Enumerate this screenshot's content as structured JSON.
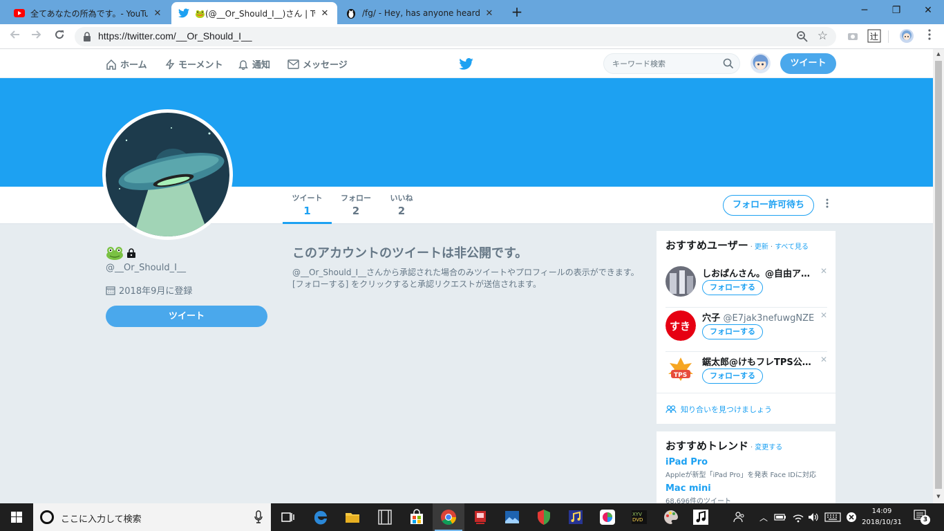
{
  "browser": {
    "tabs": [
      {
        "title": "全てあなたの所為です。- YouTube"
      },
      {
        "title": "🐸(@__Or_Should_I__)さん | Twitter"
      },
      {
        "title": "/fg/ - Hey, has anyone heard abo"
      }
    ],
    "url": "https://twitter.com/__Or_Should_I__"
  },
  "header": {
    "nav": [
      {
        "label": "ホーム"
      },
      {
        "label": "モーメント"
      },
      {
        "label": "通知"
      },
      {
        "label": "メッセージ"
      }
    ],
    "search_placeholder": "キーワード検索",
    "tweet_button": "ツイート"
  },
  "profile": {
    "stats": [
      {
        "label": "ツイート",
        "value": "1"
      },
      {
        "label": "フォロー",
        "value": "2"
      },
      {
        "label": "いいね",
        "value": "2"
      }
    ],
    "follow_button": "フォロー許可待ち",
    "handle": "@__Or_Should_I__",
    "joined": "2018年9月に登録",
    "tweet_button": "ツイート"
  },
  "protected": {
    "title": "このアカウントのツイートは非公開です。",
    "body": "@__Or_Should_I__さんから承認された場合のみツイートやプロフィールの表示ができます。[フォローする] をクリックすると承認リクエストが送信されます。"
  },
  "who_to_follow": {
    "title": "おすすめユーザー",
    "refresh": "更新",
    "view_all": "すべて見る",
    "users": [
      {
        "name": "しおぱんさん。@自由ア…",
        "screen_name": "",
        "follow": "フォローする"
      },
      {
        "name": "穴子",
        "screen_name": "@E7jak3nefuwgNZE",
        "follow": "フォローする"
      },
      {
        "name": "鋸太郎@けもフレTPS公…",
        "screen_name": "",
        "follow": "フォローする"
      }
    ],
    "find_friends": "知り合いを見つけましょう"
  },
  "trends": {
    "title": "おすすめトレンド",
    "change": "変更する",
    "items": [
      {
        "name": "iPad Pro",
        "desc": "Appleが新型「iPad Pro」を発表 Face IDに対応"
      },
      {
        "name": "Mac mini",
        "desc": "68,696件のツイート"
      }
    ]
  },
  "taskbar": {
    "search_placeholder": "ここに入力して検索",
    "time": "14:09",
    "date": "2018/10/31",
    "notifications": "3"
  }
}
